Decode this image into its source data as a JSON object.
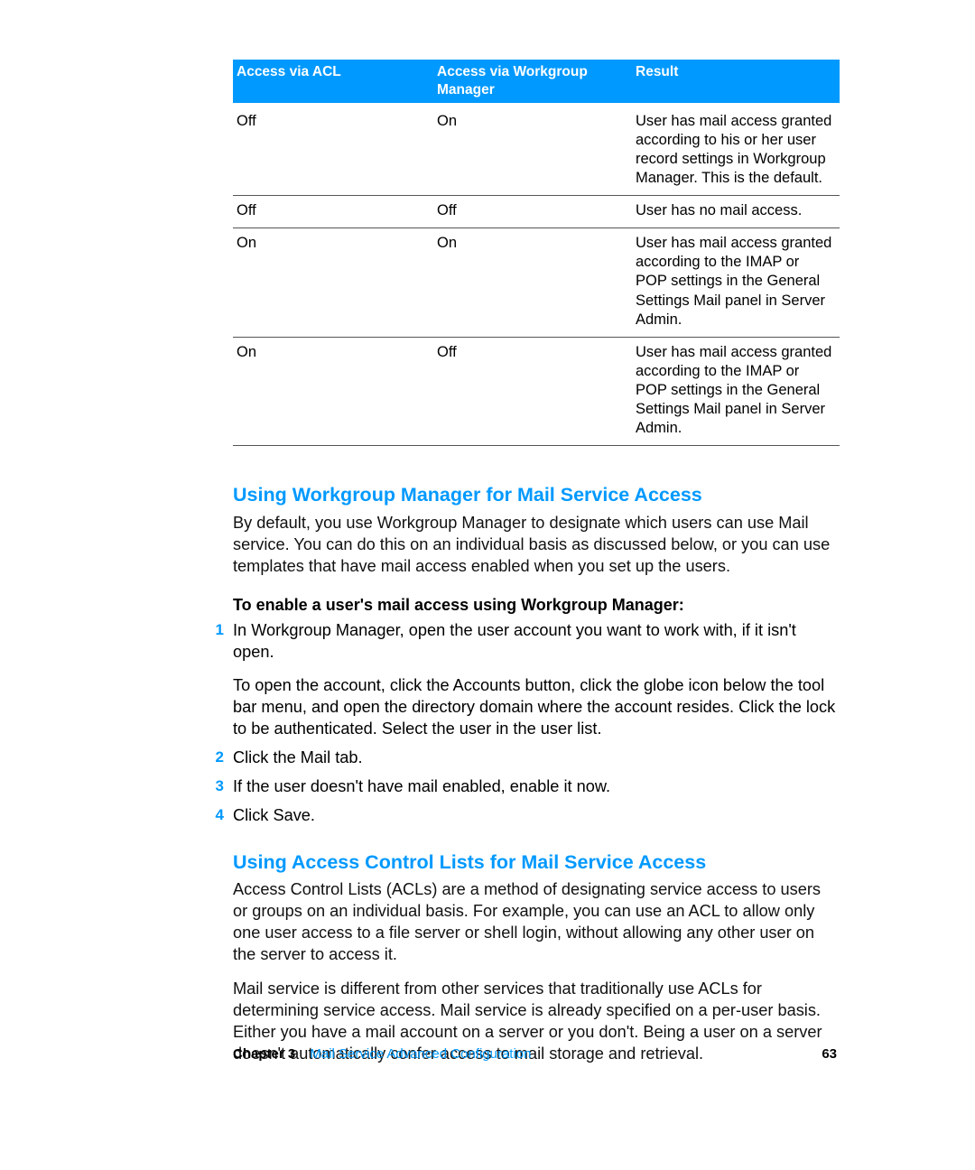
{
  "table": {
    "headers": [
      "Access via ACL",
      "Access via Workgroup Manager",
      "Result"
    ],
    "rows": [
      [
        "Off",
        "On",
        "User has mail access granted according to his or her user record settings in Workgroup Manager. This is the default."
      ],
      [
        "Off",
        "Off",
        "User has no mail access."
      ],
      [
        "On",
        "On",
        "User has mail access granted according to the IMAP or POP settings in the General Settings Mail panel in Server Admin."
      ],
      [
        "On",
        "Off",
        "User has mail access granted according to the IMAP or POP settings in the General Settings Mail panel in Server Admin."
      ]
    ]
  },
  "section1": {
    "heading": "Using Workgroup Manager for Mail Service Access",
    "intro": "By default, you use Workgroup Manager to designate which users can use Mail service. You can do this on an individual basis as discussed below, or you can use templates that have mail access enabled when you set up the users.",
    "lead": "To enable a user's mail access using Workgroup Manager:",
    "steps": [
      {
        "num": "1",
        "text": "In Workgroup Manager, open the user account you want to work with, if it isn't open.",
        "sub": "To open the account, click the Accounts button, click the globe icon below the tool bar menu, and open the directory domain where the account resides. Click the lock to be authenticated. Select the user in the user list."
      },
      {
        "num": "2",
        "text": "Click the Mail tab."
      },
      {
        "num": "3",
        "text": "If the user doesn't have mail enabled, enable it now."
      },
      {
        "num": "4",
        "text": "Click Save."
      }
    ]
  },
  "section2": {
    "heading": "Using Access Control Lists for Mail Service Access",
    "para1": "Access Control Lists (ACLs) are a method of designating service access to users or groups on an individual basis. For example, you can use an ACL to allow only one user access to a file server or shell login, without allowing any other user on the server to access it.",
    "para2": "Mail service is different from other services that traditionally use ACLs for determining service access. Mail service is already specified on a per-user basis. Either you have a mail account on a server or you don't. Being a user on a server doesn't automatically confer access to mail storage and retrieval."
  },
  "footer": {
    "chapter": "Chapter 3",
    "title": "Mail Service Advanced Configuration",
    "page": "63"
  }
}
